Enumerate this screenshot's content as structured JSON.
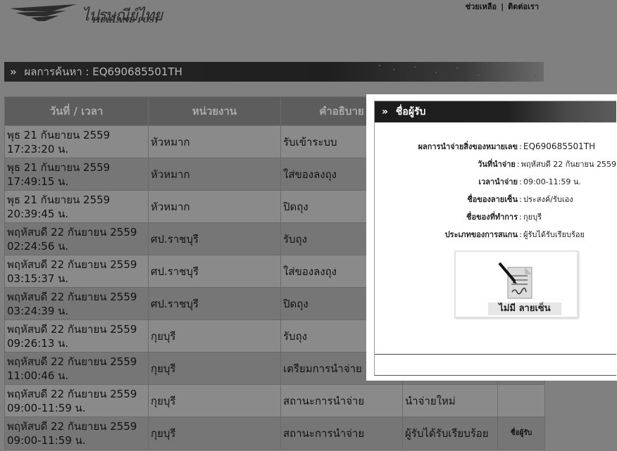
{
  "header": {
    "logo_thai": "ไปรษณีย์ไทย",
    "logo_en": "THAILAND POST",
    "links": [
      "ช่วยเหลือ",
      "ติดต่อเรา"
    ],
    "link_separator": "|"
  },
  "result_bar": {
    "label": "ผลการค้นหา",
    "separator": ":",
    "tracking_number": "EQ690685501TH"
  },
  "table": {
    "headers": [
      "วันที่ / เวลา",
      "หน่วยงาน",
      "คำอธิบาย"
    ],
    "rows": [
      {
        "date": "พุธ 21 กันยายน 2559",
        "time": "17:23:20 น.",
        "unit": "หัวหมาก",
        "desc": "รับเข้าระบบ",
        "status": "",
        "link": ""
      },
      {
        "date": "พุธ 21 กันยายน 2559",
        "time": "17:49:15 น.",
        "unit": "หัวหมาก",
        "desc": "ใส่ของลงถุง",
        "status": "",
        "link": ""
      },
      {
        "date": "พุธ 21 กันยายน 2559",
        "time": "20:39:45 น.",
        "unit": "หัวหมาก",
        "desc": "ปิดถุง",
        "status": "",
        "link": ""
      },
      {
        "date": "พฤหัสบดี 22 กันยายน 2559",
        "time": "02:24:56 น.",
        "unit": "ศป.ราชบุรี",
        "desc": "รับถุง",
        "status": "",
        "link": ""
      },
      {
        "date": "พฤหัสบดี 22 กันยายน 2559",
        "time": "03:15:37 น.",
        "unit": "ศป.ราชบุรี",
        "desc": "ใส่ของลงถุง",
        "status": "",
        "link": ""
      },
      {
        "date": "พฤหัสบดี 22 กันยายน 2559",
        "time": "03:24:39 น.",
        "unit": "ศป.ราชบุรี",
        "desc": "ปิดถุง",
        "status": "",
        "link": ""
      },
      {
        "date": "พฤหัสบดี 22 กันยายน 2559",
        "time": "09:26:13 น.",
        "unit": "กุยบุรี",
        "desc": "รับถุง",
        "status": "",
        "link": ""
      },
      {
        "date": "พฤหัสบดี 22 กันยายน 2559",
        "time": "11:00:46 น.",
        "unit": "กุยบุรี",
        "desc": "เตรียมการนำจ่าย",
        "status": "",
        "link": ""
      },
      {
        "date": "พฤหัสบดี 22 กันยายน 2559",
        "time": "09:00-11:59 น.",
        "unit": "กุยบุรี",
        "desc": "สถานะการนำจ่าย",
        "status": "นำจ่ายใหม่",
        "link": ""
      },
      {
        "date": "พฤหัสบดี 22 กันยายน 2559",
        "time": "09:00-11:59 น.",
        "unit": "กุยบุรี",
        "desc": "สถานะการนำจ่าย",
        "status": "ผู้รับได้รับเรียบร้อย",
        "link": "ชื่อผู้รับ"
      }
    ]
  },
  "popup": {
    "title": "ชื่อผู้รับ",
    "fields": [
      {
        "label": "ผลการนำจ่ายสิ่งของหมายเลข",
        "value": "EQ690685501TH"
      },
      {
        "label": "วันที่นำจ่าย",
        "value": "พฤหัสบดี 22 กันยายน 2559"
      },
      {
        "label": "เวลานำจ่าย",
        "value": "09:00-11:59 น."
      },
      {
        "label": "ชื่อของลายเซ็น",
        "value": "ประสงค์/รับเอง"
      },
      {
        "label": "ชื่อของที่ทำการ",
        "value": "กุยบุรี"
      },
      {
        "label": "ประเภทของการสแกน",
        "value": "ผู้รับได้รับเรียบร้อย"
      }
    ],
    "separator": ":",
    "signature_text": "ไม่มี ลายเซ็น",
    "signature_icon": "document-pen-icon"
  },
  "icons": {
    "chevron": "»"
  },
  "colors": {
    "overlay_gray": "#808080",
    "header_dark": "#1f1f1f",
    "popup_bg": "#ffffff"
  }
}
